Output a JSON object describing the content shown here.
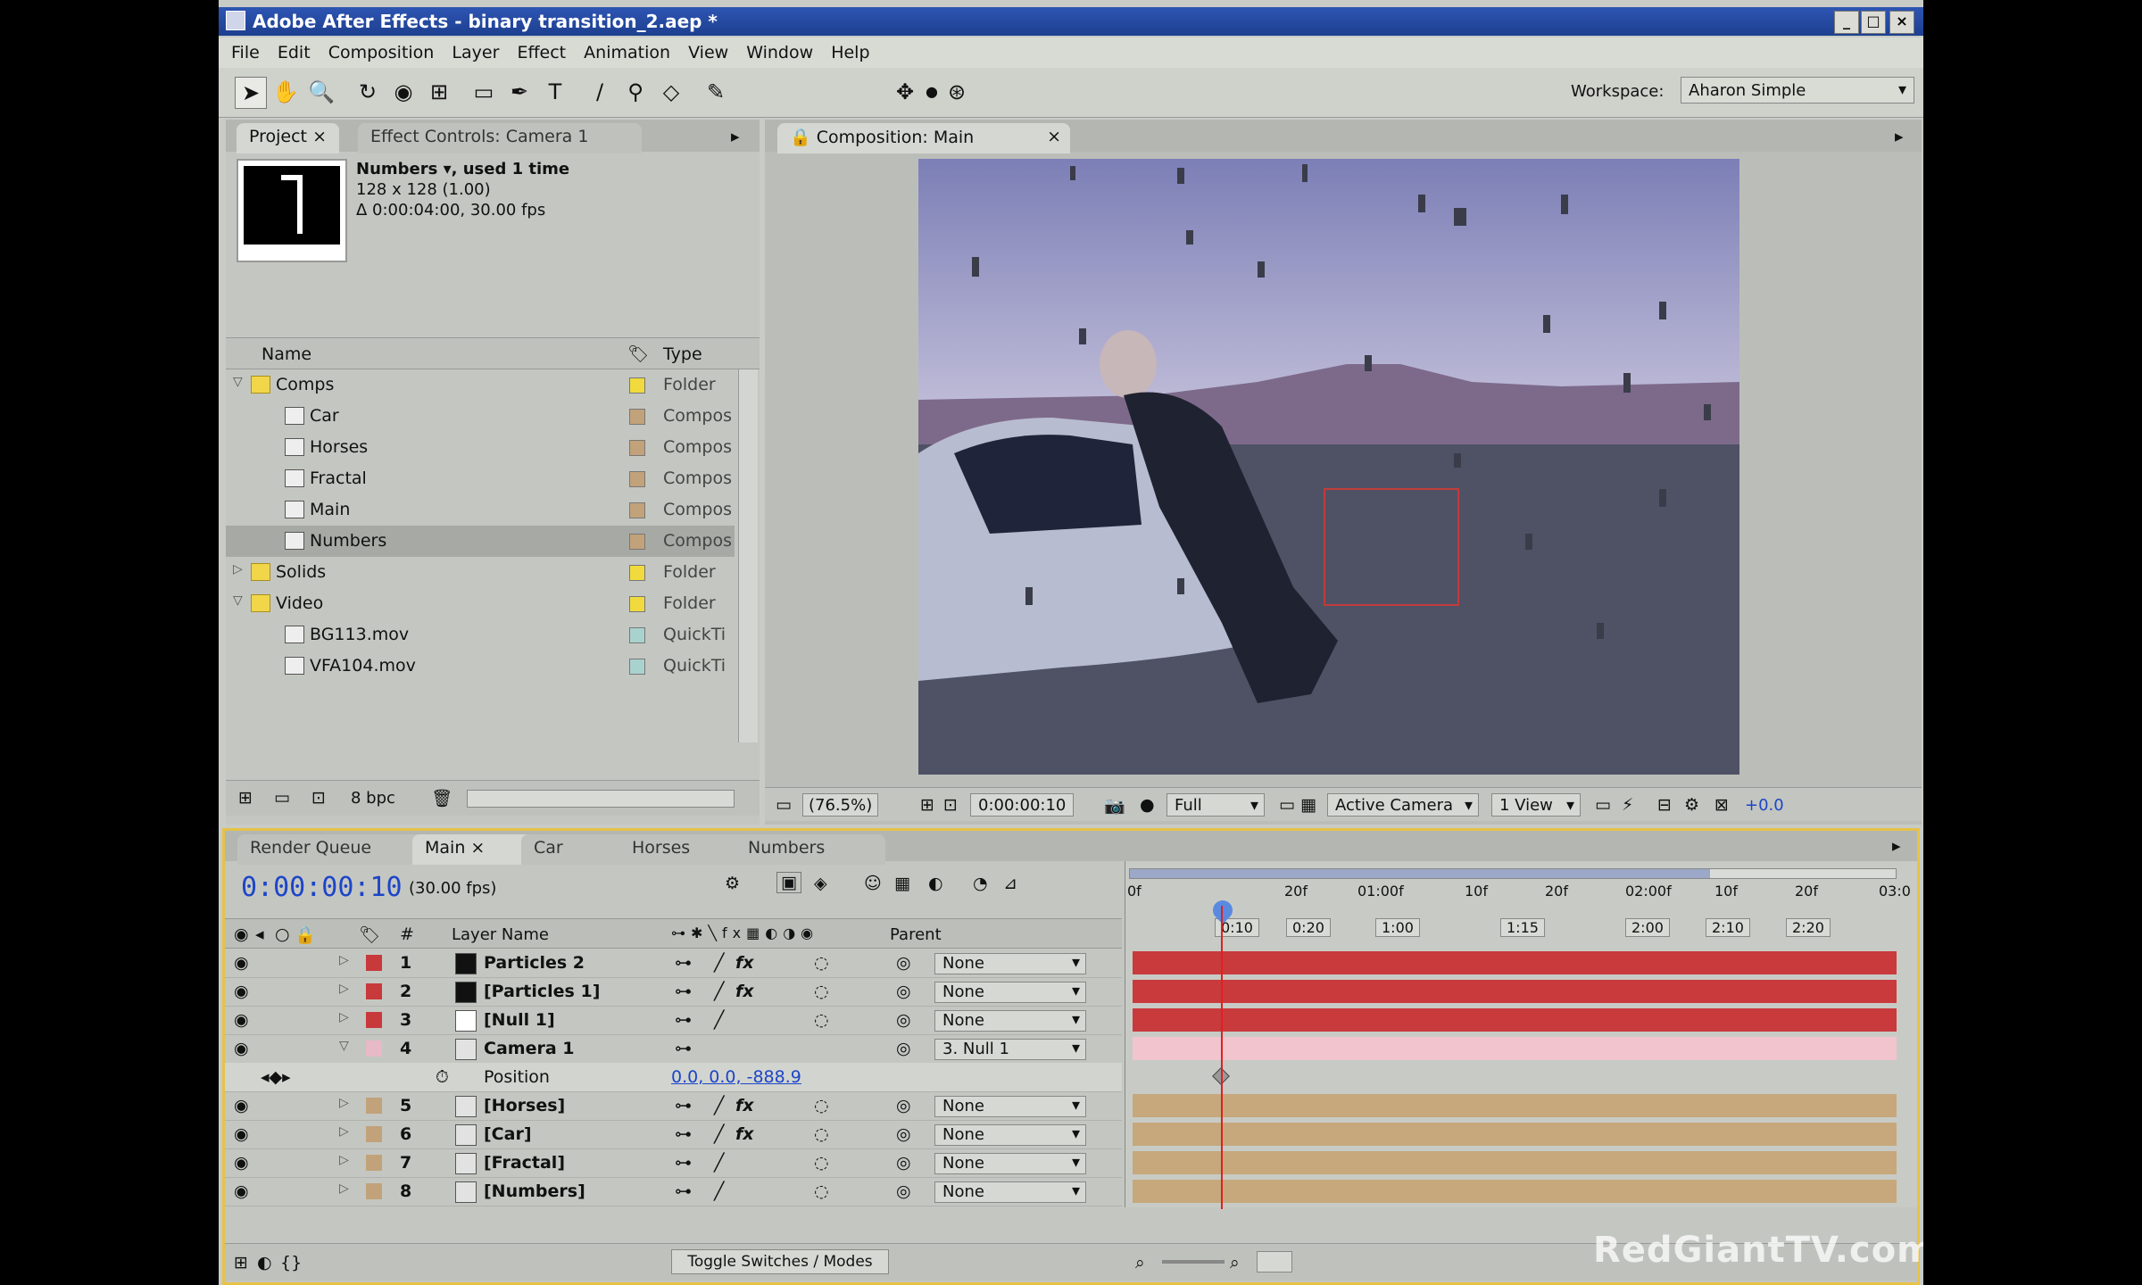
{
  "window": {
    "title": "Adobe After Effects - binary transition_2.aep *"
  },
  "menu": [
    "File",
    "Edit",
    "Composition",
    "Layer",
    "Effect",
    "Animation",
    "View",
    "Window",
    "Help"
  ],
  "toolbar": {
    "workspace_label": "Workspace:",
    "workspace_value": "Aharon Simple"
  },
  "project_panel": {
    "tabs": [
      "Project",
      "Effect Controls: Camera 1"
    ],
    "preview_info": {
      "name": "Numbers ▾, used 1 time",
      "size": "128 x 128 (1.00)",
      "duration": "Δ 0:00:04:00, 30.00 fps"
    },
    "columns": {
      "name": "Name",
      "type": "Type"
    },
    "items": [
      {
        "name": "Comps",
        "type": "Folder",
        "color": "#f1da3d",
        "kind": "folder",
        "indent": 0,
        "open": true
      },
      {
        "name": "Car",
        "type": "Compos",
        "color": "#c2a27a",
        "kind": "comp",
        "indent": 1
      },
      {
        "name": "Horses",
        "type": "Compos",
        "color": "#c2a27a",
        "kind": "comp",
        "indent": 1
      },
      {
        "name": "Fractal",
        "type": "Compos",
        "color": "#c2a27a",
        "kind": "comp",
        "indent": 1
      },
      {
        "name": "Main",
        "type": "Compos",
        "color": "#c2a27a",
        "kind": "comp",
        "indent": 1
      },
      {
        "name": "Numbers",
        "type": "Compos",
        "color": "#c2a27a",
        "kind": "comp",
        "indent": 1,
        "selected": true
      },
      {
        "name": "Solids",
        "type": "Folder",
        "color": "#f1da3d",
        "kind": "folder",
        "indent": 0,
        "open": false
      },
      {
        "name": "Video",
        "type": "Folder",
        "color": "#f1da3d",
        "kind": "folder",
        "indent": 0,
        "open": true
      },
      {
        "name": "BG113.mov",
        "type": "QuickTi",
        "color": "#a9d2cf",
        "kind": "file",
        "indent": 1
      },
      {
        "name": "VFA104.mov",
        "type": "QuickTi",
        "color": "#a9d2cf",
        "kind": "file",
        "indent": 1
      }
    ],
    "footer_bpc": "8 bpc"
  },
  "comp_panel": {
    "tab": "Composition: Main",
    "zoom": "(76.5%)",
    "timecode": "0:00:00:10",
    "resolution": "Full",
    "camera": "Active Camera",
    "views": "1 View",
    "exposure": "+0.0"
  },
  "timeline": {
    "tabs": [
      "Render Queue",
      "Main",
      "Car",
      "Horses",
      "Numbers"
    ],
    "active_tab": "Main",
    "timecode": "0:00:00:10",
    "fps": "(30.00 fps)",
    "ruler_labels": [
      "0f",
      "20f",
      "01:00f",
      "10f",
      "20f",
      "02:00f",
      "10f",
      "20f",
      "03:0"
    ],
    "marker_labels": [
      "0:10",
      "0:20",
      "1:00",
      "1:15",
      "2:00",
      "2:10",
      "2:20"
    ],
    "col_layer_name": "Layer Name",
    "col_parent": "Parent",
    "layers": [
      {
        "num": "1",
        "name": "Particles 2",
        "label": "#c8393b",
        "swatch": "#111111",
        "parent": "None",
        "bar": "#c93a3d",
        "fx": true
      },
      {
        "num": "2",
        "name": "[Particles 1]",
        "label": "#c8393b",
        "swatch": "#111111",
        "parent": "None",
        "bar": "#c93a3d",
        "fx": true
      },
      {
        "num": "3",
        "name": "[Null 1]",
        "label": "#c8393b",
        "swatch": "#ffffff",
        "parent": "None",
        "bar": "#c93a3d",
        "fx": false
      },
      {
        "num": "4",
        "name": "Camera 1",
        "label": "#e8b9c6",
        "swatch": "camera",
        "parent": "3. Null 1",
        "bar": "#f1c4ce",
        "fx": false
      },
      {
        "num": "5",
        "name": "[Horses]",
        "label": "#c2a27a",
        "swatch": "comp",
        "parent": "None",
        "bar": "#c6a87c",
        "fx": true
      },
      {
        "num": "6",
        "name": "[Car]",
        "label": "#c2a27a",
        "swatch": "comp",
        "parent": "None",
        "bar": "#c6a87c",
        "fx": true
      },
      {
        "num": "7",
        "name": "[Fractal]",
        "label": "#c2a27a",
        "swatch": "comp",
        "parent": "None",
        "bar": "#c6a87c",
        "fx": false
      },
      {
        "num": "8",
        "name": "[Numbers]",
        "label": "#c2a27a",
        "swatch": "comp",
        "parent": "None",
        "bar": "#c6a87c",
        "fx": false
      }
    ],
    "position_property": {
      "name": "Position",
      "value": "0.0, 0.0, -888.9"
    },
    "toggle_label": "Toggle Switches / Modes"
  },
  "watermark": "RedGiantTV.com"
}
